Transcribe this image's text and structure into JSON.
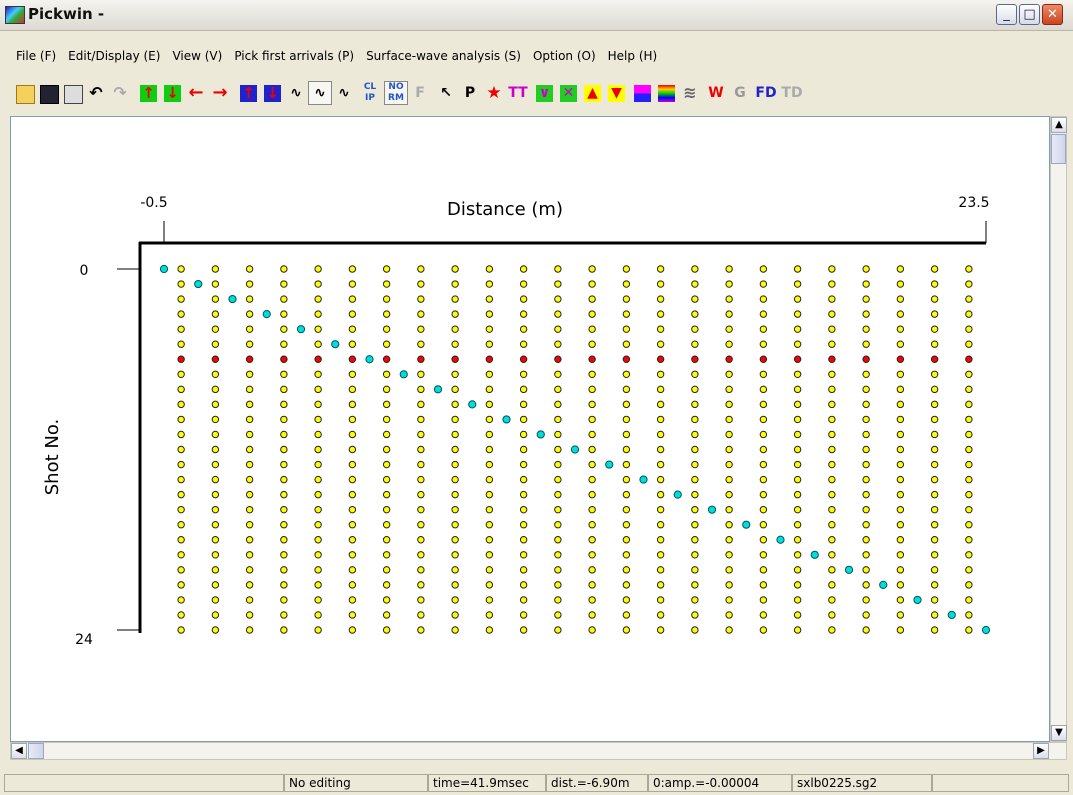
{
  "window": {
    "title": "Pickwin -"
  },
  "menu": [
    "File (F)",
    "Edit/Display (E)",
    "View (V)",
    "Pick first arrivals (P)",
    "Surface-wave analysis (S)",
    "Option (O)",
    "Help (H)"
  ],
  "toolbar": [
    {
      "name": "open-icon"
    },
    {
      "name": "save-icon"
    },
    {
      "name": "print-icon"
    },
    {
      "name": "undo-icon"
    },
    {
      "name": "redo-icon"
    },
    {
      "name": "up-arrow-green-icon"
    },
    {
      "name": "down-arrow-green-icon"
    },
    {
      "name": "left-arrow-red-icon"
    },
    {
      "name": "right-arrow-red-icon"
    },
    {
      "name": "up-arrow-blue-icon"
    },
    {
      "name": "down-arrow-blue-icon"
    },
    {
      "name": "wiggle-icon"
    },
    {
      "name": "wiggle-fill-icon"
    },
    {
      "name": "wiggle-variable-icon"
    },
    {
      "name": "clip-icon",
      "text": "CL IP"
    },
    {
      "name": "norm-icon",
      "text": "NO RM"
    },
    {
      "name": "filter-icon",
      "text": "F"
    },
    {
      "name": "pointer-icon"
    },
    {
      "name": "pick-icon",
      "text": "P"
    },
    {
      "name": "star-icon"
    },
    {
      "name": "tt-icon",
      "text": "TT"
    },
    {
      "name": "green-check-icon"
    },
    {
      "name": "cross-icon"
    },
    {
      "name": "triangle-up-icon"
    },
    {
      "name": "triangle-down-icon"
    },
    {
      "name": "color-bar-icon"
    },
    {
      "name": "rainbow-icon"
    },
    {
      "name": "wave-icon"
    },
    {
      "name": "w-icon",
      "text": "W"
    },
    {
      "name": "g-icon",
      "text": "G"
    },
    {
      "name": "fd-icon",
      "text": "FD"
    },
    {
      "name": "td-icon",
      "text": "TD"
    }
  ],
  "plot": {
    "x_axis_title": "Distance (m)",
    "x_min_label": "-0.5",
    "x_max_label": "23.5",
    "y_axis_title": "Shot No.",
    "y_min_label": "0",
    "y_max_label": "24"
  },
  "chart_data": {
    "type": "scatter",
    "title": "",
    "xlabel": "Distance (m)",
    "ylabel": "Shot No.",
    "xlim": [
      -0.5,
      23.5
    ],
    "ylim": [
      0,
      24
    ],
    "receiver_positions_m": [
      0,
      1,
      2,
      3,
      4,
      5,
      6,
      7,
      8,
      9,
      10,
      11,
      12,
      13,
      14,
      15,
      16,
      17,
      18,
      19,
      20,
      21,
      22,
      23
    ],
    "shot_numbers": [
      0,
      1,
      2,
      3,
      4,
      5,
      6,
      7,
      8,
      9,
      10,
      11,
      12,
      13,
      14,
      15,
      16,
      17,
      18,
      19,
      20,
      21,
      22,
      23,
      24
    ],
    "series": [
      {
        "name": "Receivers",
        "color": "#ffff00",
        "note_rows": "all shots"
      },
      {
        "name": "Selected shot receivers",
        "color": "#ff0000",
        "shot": 6
      },
      {
        "name": "Shot points",
        "color": "#00dddd",
        "points": [
          [
            -0.5,
            0
          ],
          [
            0.5,
            1
          ],
          [
            1.5,
            2
          ],
          [
            2.5,
            3
          ],
          [
            3.5,
            4
          ],
          [
            4.5,
            5
          ],
          [
            5.5,
            6
          ],
          [
            6.5,
            7
          ],
          [
            7.5,
            8
          ],
          [
            8.5,
            9
          ],
          [
            9.5,
            10
          ],
          [
            10.5,
            11
          ],
          [
            11.5,
            12
          ],
          [
            12.5,
            13
          ],
          [
            13.5,
            14
          ],
          [
            14.5,
            15
          ],
          [
            15.5,
            16
          ],
          [
            16.5,
            17
          ],
          [
            17.5,
            18
          ],
          [
            18.5,
            19
          ],
          [
            19.5,
            20
          ],
          [
            20.5,
            21
          ],
          [
            21.5,
            22
          ],
          [
            22.5,
            23
          ],
          [
            23.5,
            24
          ]
        ]
      }
    ]
  },
  "status": [
    "",
    "No editing",
    "time=41.9msec",
    "dist.=-6.90m",
    "0:amp.=-0.00004",
    "sxlb0225.sg2"
  ],
  "colors": {
    "receiver": "#ffff00",
    "selected": "#ff0000",
    "shot": "#00dddd"
  }
}
